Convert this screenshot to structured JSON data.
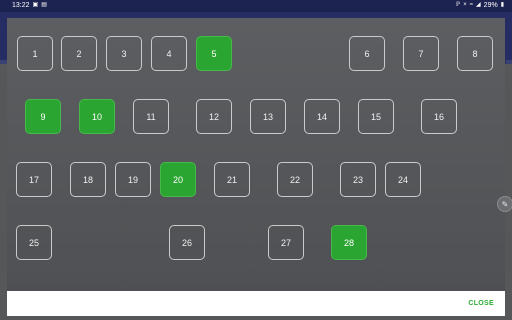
{
  "status_bar": {
    "time": "13:22",
    "notification_icons": [
      "image-icon",
      "clipboard-icon"
    ],
    "system_icons": [
      "bluetooth-icon",
      "mute-icon",
      "wifi-icon",
      "signal-icon"
    ],
    "battery_percent": "29%"
  },
  "dialog": {
    "days": [
      {
        "label": "1",
        "selected": false
      },
      {
        "label": "2",
        "selected": false
      },
      {
        "label": "3",
        "selected": false
      },
      {
        "label": "4",
        "selected": false
      },
      {
        "label": "5",
        "selected": true
      },
      {
        "label": "6",
        "selected": false
      },
      {
        "label": "7",
        "selected": false
      },
      {
        "label": "8",
        "selected": false
      },
      {
        "label": "9",
        "selected": true
      },
      {
        "label": "10",
        "selected": true
      },
      {
        "label": "11",
        "selected": false
      },
      {
        "label": "12",
        "selected": false
      },
      {
        "label": "13",
        "selected": false
      },
      {
        "label": "14",
        "selected": false
      },
      {
        "label": "15",
        "selected": false
      },
      {
        "label": "16",
        "selected": false
      },
      {
        "label": "17",
        "selected": false
      },
      {
        "label": "18",
        "selected": false
      },
      {
        "label": "19",
        "selected": false
      },
      {
        "label": "20",
        "selected": true
      },
      {
        "label": "21",
        "selected": false
      },
      {
        "label": "22",
        "selected": false
      },
      {
        "label": "23",
        "selected": false
      },
      {
        "label": "24",
        "selected": false
      },
      {
        "label": "25",
        "selected": false
      },
      {
        "label": "26",
        "selected": false
      },
      {
        "label": "27",
        "selected": false
      },
      {
        "label": "28",
        "selected": true
      }
    ],
    "close_label": "CLOSE"
  },
  "colors": {
    "selected": "#2ba531",
    "app_bar": "#252d62",
    "status_bar": "#1d2350",
    "close_text": "#2eaa35"
  }
}
